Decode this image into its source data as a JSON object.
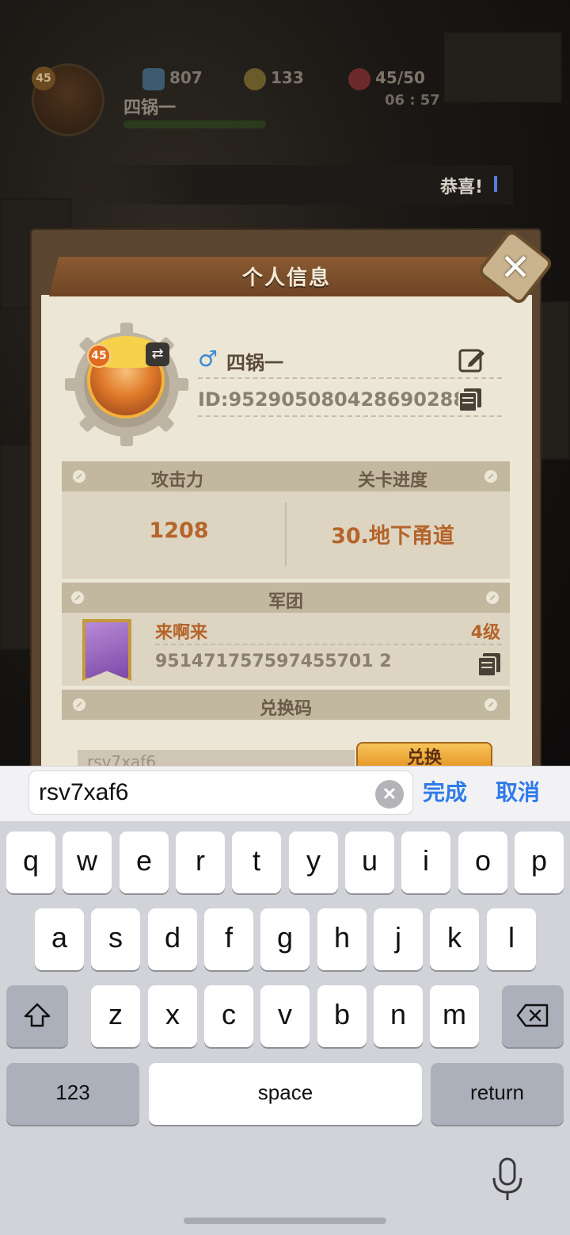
{
  "hud": {
    "level": "45",
    "player_name": "四锅一",
    "resource_1": "807",
    "resource_2": "133",
    "energy": "45/50",
    "timer": "06 : 57"
  },
  "banner": {
    "text": "恭喜!"
  },
  "dialog": {
    "title": "个人信息",
    "close_icon": "close-icon",
    "profile": {
      "level": "45",
      "gender_symbol": "♂",
      "name": "四锅一",
      "id": "ID:952905080428690288"
    },
    "stats": {
      "attack_label": "攻击力",
      "attack_value": "1208",
      "stage_label": "关卡进度",
      "stage_value": "30.地下甬道"
    },
    "legion": {
      "label": "军团",
      "name": "来啊来",
      "level": "4级",
      "id": "951471757597455701 2"
    },
    "redeem": {
      "label": "兑换码",
      "field_value": "rsv7xaf6",
      "button_label": "兑换"
    }
  },
  "accessory": {
    "input_value": "rsv7xaf6",
    "done_label": "完成",
    "cancel_label": "取消"
  },
  "keyboard": {
    "row1": [
      "q",
      "w",
      "e",
      "r",
      "t",
      "y",
      "u",
      "i",
      "o",
      "p"
    ],
    "row2": [
      "a",
      "s",
      "d",
      "f",
      "g",
      "h",
      "j",
      "k",
      "l"
    ],
    "row3": [
      "z",
      "x",
      "c",
      "v",
      "b",
      "n",
      "m"
    ],
    "numbers_label": "123",
    "space_label": "space",
    "return_label": "return"
  },
  "colors": {
    "accent_blue": "#2f7be9",
    "dialog_header": "#7a4e2a",
    "value_orange": "#b5642a",
    "keyboard_bg": "#d1d3d9"
  }
}
